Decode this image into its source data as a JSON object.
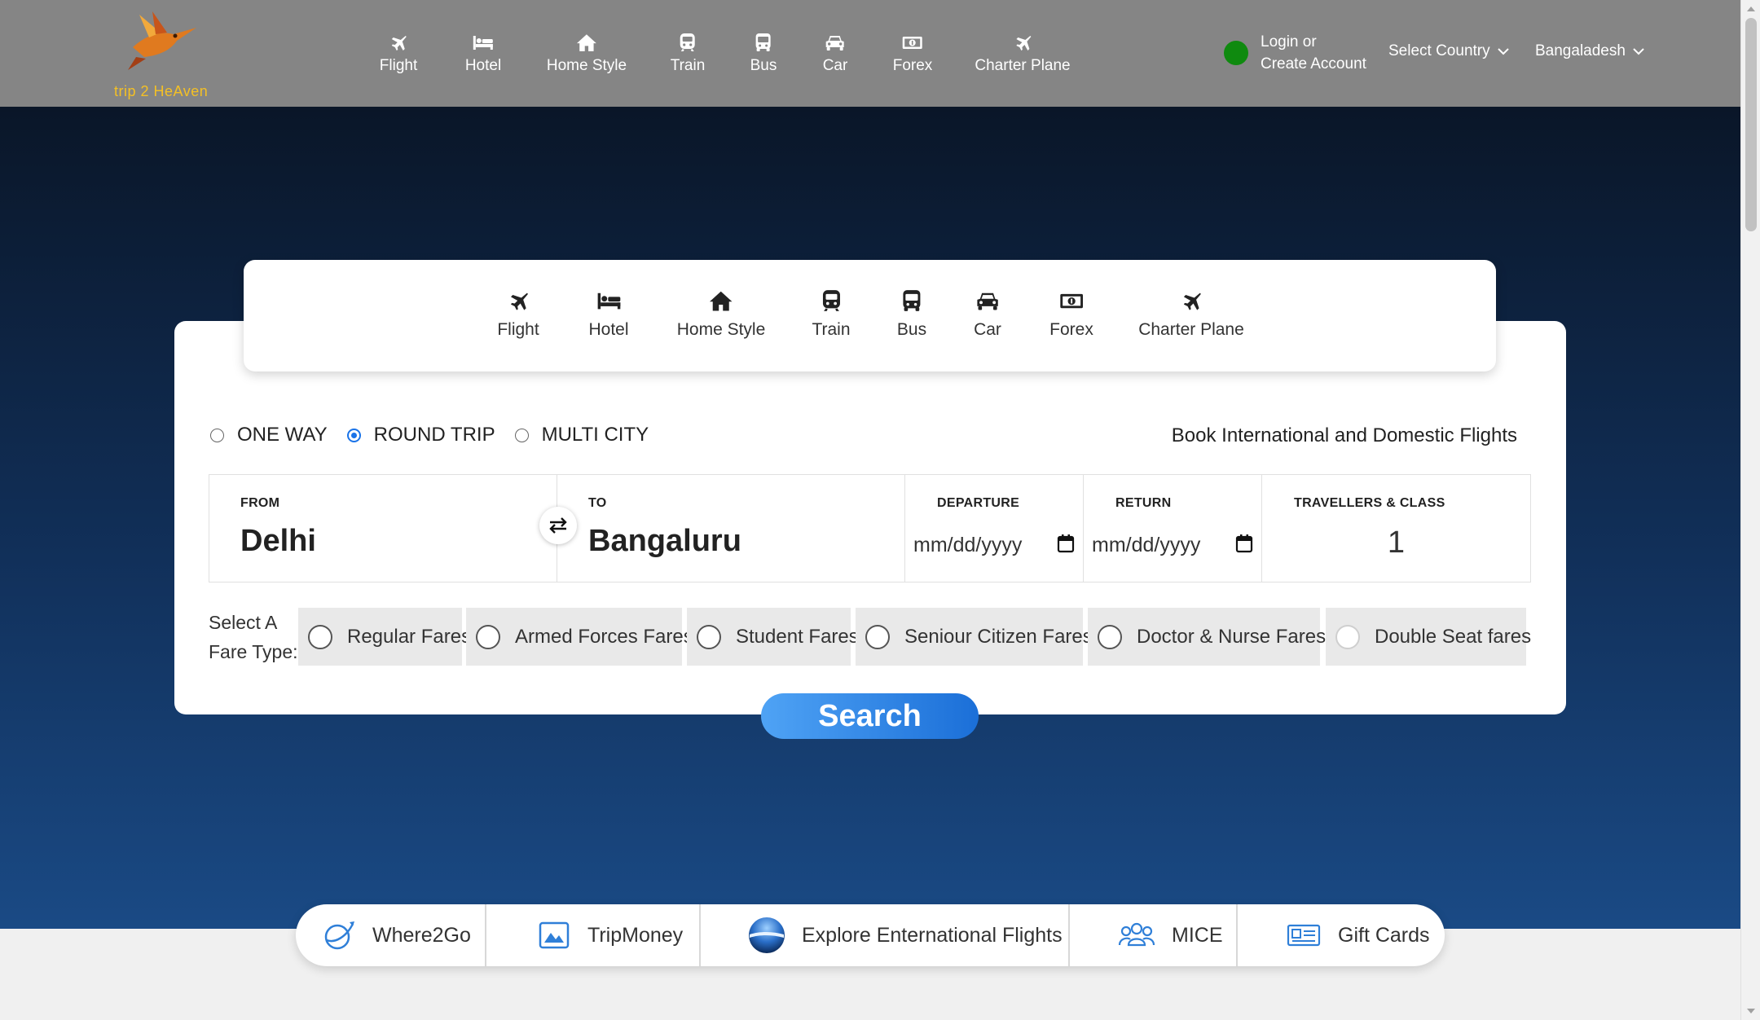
{
  "brand": {
    "logo_text": "trip 2 HeAven"
  },
  "nav": {
    "items": [
      {
        "label": "Flight",
        "icon": "plane-icon"
      },
      {
        "label": "Hotel",
        "icon": "bed-icon"
      },
      {
        "label": "Home Style",
        "icon": "home-icon"
      },
      {
        "label": "Train",
        "icon": "train-icon"
      },
      {
        "label": "Bus",
        "icon": "bus-icon"
      },
      {
        "label": "Car",
        "icon": "car-icon"
      },
      {
        "label": "Forex",
        "icon": "money-icon"
      },
      {
        "label": "Charter Plane",
        "icon": "plane-icon"
      }
    ],
    "login_line1": "Login or",
    "login_line2": "Create Account",
    "country_select": "Select Country",
    "country_value": "Bangaladesh",
    "status_color": "#0f8a0f"
  },
  "tabs": [
    {
      "label": "Flight",
      "icon": "plane-icon"
    },
    {
      "label": "Hotel",
      "icon": "bed-icon"
    },
    {
      "label": "Home Style",
      "icon": "home-icon"
    },
    {
      "label": "Train",
      "icon": "train-icon"
    },
    {
      "label": "Bus",
      "icon": "bus-icon"
    },
    {
      "label": "Car",
      "icon": "car-icon"
    },
    {
      "label": "Forex",
      "icon": "money-icon"
    },
    {
      "label": "Charter Plane",
      "icon": "plane-icon"
    }
  ],
  "trip_type": {
    "options": [
      "ONE WAY",
      "ROUND TRIP",
      "MULTI CITY"
    ],
    "selected": "ROUND TRIP"
  },
  "headline": "Book International and Domestic Flights",
  "search_form": {
    "from_label": "FROM",
    "from_value": "Delhi",
    "to_label": "TO",
    "to_value": "Bangaluru",
    "departure_label": "DEPARTURE",
    "departure_placeholder": "mm/dd/yyyy",
    "return_label": "RETURN",
    "return_placeholder": "mm/dd/yyyy",
    "travellers_label": "TRAVELLERS & CLASS",
    "travellers_value": "1"
  },
  "fare_type": {
    "label_line1": "Select A",
    "label_line2": "Fare Type:",
    "options": [
      "Regular Fares",
      "Armed Forces Fares",
      "Student Fares",
      "Seniour Citizen Fares",
      "Doctor & Nurse Fares",
      "Double Seat fares"
    ]
  },
  "search_button": "Search",
  "quick_links": [
    {
      "label": "Where2Go",
      "icon": "globe-plane-icon"
    },
    {
      "label": "TripMoney",
      "icon": "image-icon"
    },
    {
      "label": "Explore Enternational Flights",
      "icon": "earth-icon"
    },
    {
      "label": "MICE",
      "icon": "group-icon"
    },
    {
      "label": "Gift Cards",
      "icon": "gift-card-icon"
    }
  ],
  "colors": {
    "accent": "#1a73e8",
    "topbar": "#858585",
    "hero_top": "#0a1628",
    "hero_bottom": "#1a4a85"
  }
}
